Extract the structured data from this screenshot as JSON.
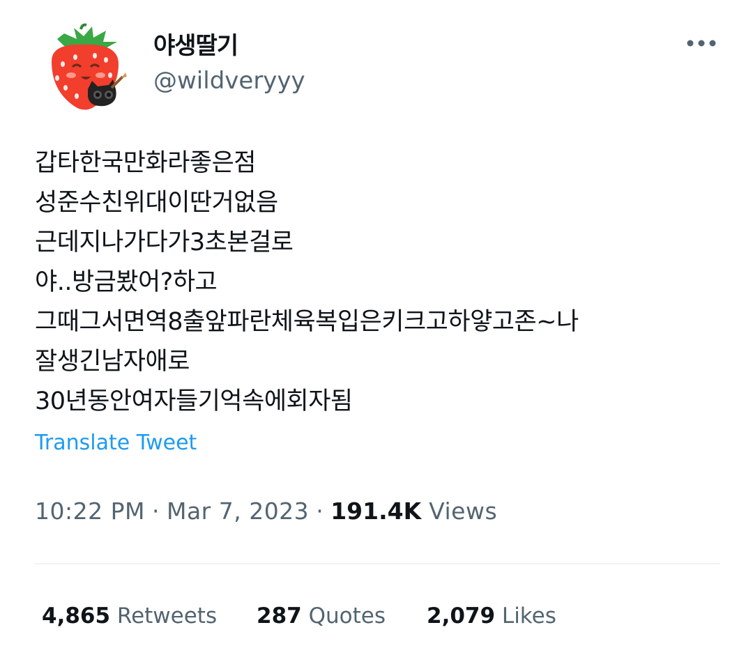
{
  "user": {
    "display_name": "야생딸기",
    "handle": "@wildveryyy",
    "avatar_icon": "strawberry-character-avatar"
  },
  "more_icon": "more-horizontal-icon",
  "tweet": {
    "lines": [
      "갑타한국만화라좋은점",
      "성준수친위대이딴거없음",
      "근데지나가다가3초본걸로",
      "야..방금봤어?하고",
      "그때그서면역8출앞파란체육복입은키크고하얗고존~나",
      "잘생긴남자애로",
      "30년동안여자들기억속에회자됨"
    ],
    "translate_label": "Translate Tweet"
  },
  "meta": {
    "time": "10:22 PM",
    "separator": "·",
    "date": "Mar 7, 2023",
    "views_count": "191.4K",
    "views_label": "Views"
  },
  "stats": {
    "retweets_count": "4,865",
    "retweets_label": "Retweets",
    "quotes_count": "287",
    "quotes_label": "Quotes",
    "likes_count": "2,079",
    "likes_label": "Likes"
  },
  "colors": {
    "link": "#1d9bf0",
    "secondary_text": "#536471",
    "primary_text": "#0f1419",
    "divider": "#eff3f4"
  }
}
